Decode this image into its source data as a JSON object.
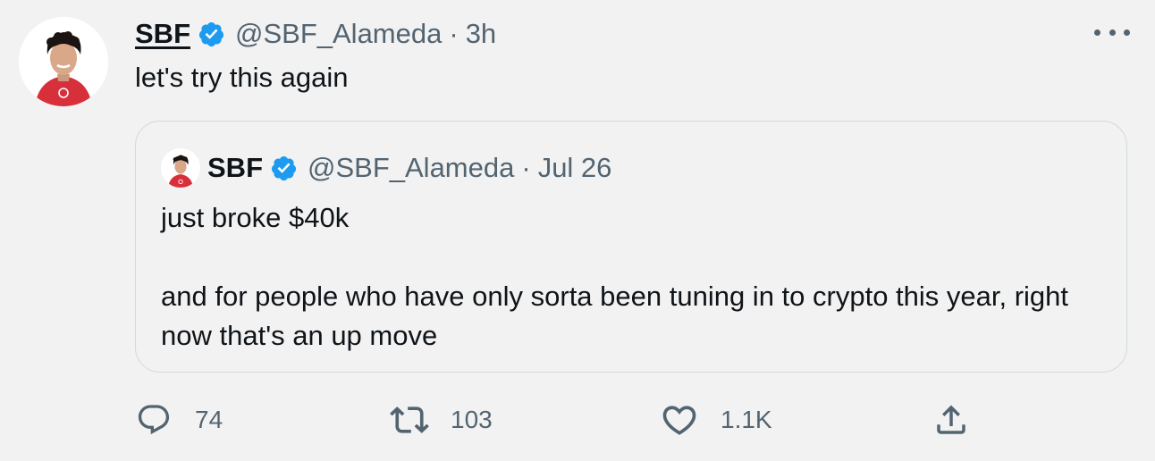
{
  "tweet": {
    "author_name": "SBF",
    "handle": "@SBF_Alameda",
    "separator": "·",
    "time": "3h",
    "text": "let's try this again",
    "avatar_icon": "profile-avatar",
    "verified_icon": "verified-badge-icon",
    "more_icon": "more-options-icon"
  },
  "quoted_tweet": {
    "author_name": "SBF",
    "handle": "@SBF_Alameda",
    "separator": "·",
    "date": "Jul 26",
    "text": "just broke $40k\n\nand for people who have only sorta been tuning in to crypto this year, right now that's an up move"
  },
  "actions": {
    "reply_count": "74",
    "retweet_count": "103",
    "like_count": "1.1K",
    "reply_icon": "reply-icon",
    "retweet_icon": "retweet-icon",
    "like_icon": "heart-icon",
    "share_icon": "share-icon"
  },
  "colors": {
    "background": "#f2f2f2",
    "text": "#0f1419",
    "secondary": "#536471",
    "verified": "#1d9bf0",
    "border": "#cfd9de",
    "shirt": "#d7303a"
  }
}
